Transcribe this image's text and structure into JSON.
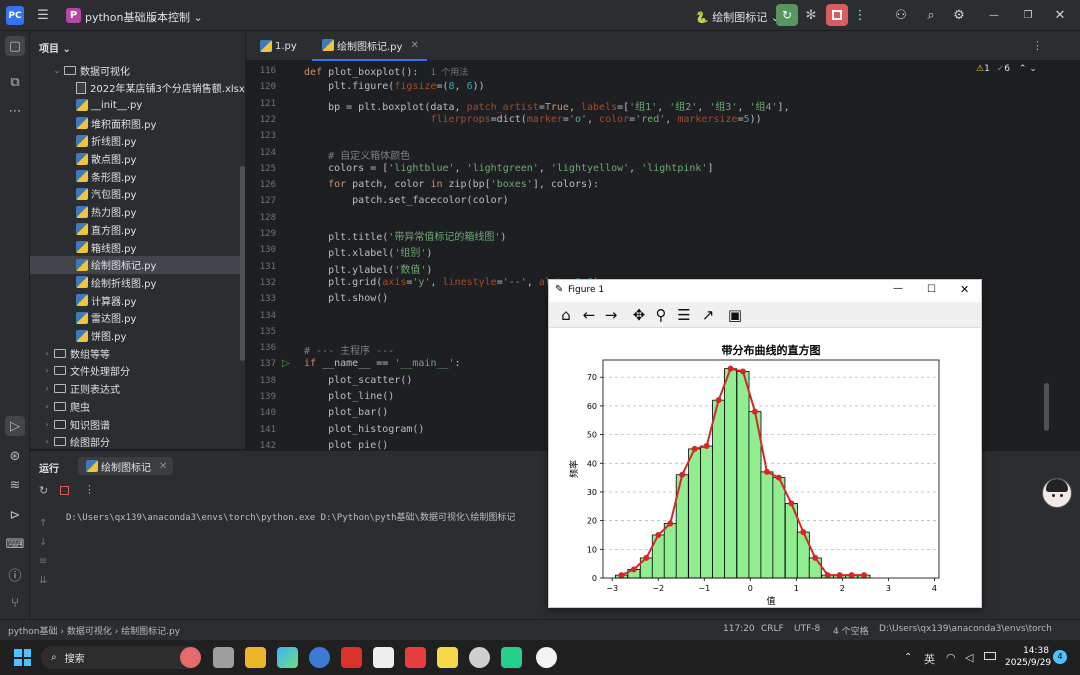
{
  "titlebar": {
    "project_badge": "P",
    "project_name": "python基础",
    "vcs": "版本控制",
    "run_config": "绘制图标记",
    "colors": {
      "run": "#57965c",
      "stop": "#db5c5c"
    }
  },
  "project_panel": {
    "title": "项目",
    "root": "数据可视化",
    "files": [
      "2022年某店铺3个分店销售额.xlsx",
      "__init__.py",
      "堆积面积图.py",
      "折线图.py",
      "散点图.py",
      "条形图.py",
      "汽包图.py",
      "热力图.py",
      "直方图.py",
      "箱线图.py",
      "绘制图标记.py",
      "绘制折线图.py",
      "计算器.py",
      "雷达图.py",
      "饼图.py"
    ],
    "selected": "绘制图标记.py",
    "folders": [
      "数组等等",
      "文件处理部分",
      "正则表达式",
      "爬虫",
      "知识图谱",
      "绘图部分"
    ]
  },
  "tabs": [
    {
      "label": "1.py"
    },
    {
      "label": "绘制图标记.py"
    }
  ],
  "editor": {
    "warn_count": "1",
    "check_count": "6",
    "usage_hint": "1 个用法",
    "lines": [
      {
        "n": "116",
        "t": "def plot_boxplot():"
      },
      {
        "n": "120",
        "t": "    plt.figure(figsize=(8, 6))"
      },
      {
        "n": "121",
        "t": "    bp = plt.boxplot(data, patch_artist=True, labels=['组1', '组2', '组3', '组4'],"
      },
      {
        "n": "122",
        "t": "                     flierprops=dict(marker='o', color='red', markersize=5))"
      },
      {
        "n": "123",
        "t": ""
      },
      {
        "n": "124",
        "t": "    # 自定义箱体颜色"
      },
      {
        "n": "125",
        "t": "    colors = ['lightblue', 'lightgreen', 'lightyellow', 'lightpink']"
      },
      {
        "n": "126",
        "t": "    for patch, color in zip(bp['boxes'], colors):"
      },
      {
        "n": "127",
        "t": "        patch.set_facecolor(color)"
      },
      {
        "n": "128",
        "t": ""
      },
      {
        "n": "129",
        "t": "    plt.title('带异常值标记的箱线图')"
      },
      {
        "n": "130",
        "t": "    plt.xlabel('组别')"
      },
      {
        "n": "131",
        "t": "    plt.ylabel('数值')"
      },
      {
        "n": "132",
        "t": "    plt.grid(axis='y', linestyle='--', alpha=0.6)"
      },
      {
        "n": "133",
        "t": "    plt.show()"
      },
      {
        "n": "134",
        "t": ""
      },
      {
        "n": "135",
        "t": ""
      },
      {
        "n": "136",
        "t": "# --- 主程序 ---"
      },
      {
        "n": "137",
        "t": "if __name__ == '__main__':"
      },
      {
        "n": "138",
        "t": "    plot_scatter()"
      },
      {
        "n": "139",
        "t": "    plot_line()"
      },
      {
        "n": "140",
        "t": "    plot_bar()"
      },
      {
        "n": "141",
        "t": "    plot_histogram()"
      },
      {
        "n": "142",
        "t": "    plot_pie()"
      }
    ]
  },
  "run": {
    "title": "运行",
    "tab": "绘制图标记",
    "output": "D:\\Users\\qx139\\anaconda3\\envs\\torch\\python.exe D:\\Python\\pyth基础\\数据可视化\\绘制图标记"
  },
  "statusbar": {
    "crumbs": [
      "python基础",
      "数据可视化",
      "绘制图标记.py"
    ],
    "position": "117:20",
    "line_sep": "CRLF",
    "encoding": "UTF-8",
    "indent": "4 个空格",
    "interpreter": "D:\\Users\\qx139\\anaconda3\\envs\\torch"
  },
  "taskbar": {
    "search": "搜索",
    "ime": "英",
    "time": "14:38",
    "date": "2025/9/29",
    "notif": "4"
  },
  "figure": {
    "title": "Figure 1",
    "toolbar_icons": [
      "home-icon",
      "back-icon",
      "forward-icon",
      "pan-icon",
      "zoom-icon",
      "configure-icon",
      "axes-edit-icon",
      "save-icon"
    ]
  },
  "chart_data": {
    "type": "bar",
    "title": "带分布曲线的直方图",
    "xlabel": "值",
    "ylabel": "频率",
    "xlim": [
      -3.2,
      4.1
    ],
    "ylim": [
      0,
      76
    ],
    "xticks": [
      -3,
      -2,
      -1,
      0,
      1,
      2,
      3,
      4
    ],
    "yticks": [
      0,
      10,
      20,
      30,
      40,
      50,
      60,
      70
    ],
    "grid": "y-dashed",
    "bar_color": "#90ee90",
    "line_color": "#d62728",
    "bins": [
      {
        "x": -2.93,
        "v": 1
      },
      {
        "x": -2.66,
        "v": 3
      },
      {
        "x": -2.39,
        "v": 7
      },
      {
        "x": -2.13,
        "v": 15
      },
      {
        "x": -1.87,
        "v": 19
      },
      {
        "x": -1.61,
        "v": 36
      },
      {
        "x": -1.34,
        "v": 45
      },
      {
        "x": -1.08,
        "v": 46
      },
      {
        "x": -0.82,
        "v": 62
      },
      {
        "x": -0.56,
        "v": 73
      },
      {
        "x": -0.29,
        "v": 72
      },
      {
        "x": -0.03,
        "v": 58
      },
      {
        "x": 0.23,
        "v": 37
      },
      {
        "x": 0.49,
        "v": 35
      },
      {
        "x": 0.76,
        "v": 26
      },
      {
        "x": 1.02,
        "v": 16
      },
      {
        "x": 1.28,
        "v": 7
      },
      {
        "x": 1.55,
        "v": 1
      },
      {
        "x": 1.81,
        "v": 1
      },
      {
        "x": 2.07,
        "v": 1
      },
      {
        "x": 2.34,
        "v": 1
      }
    ],
    "bin_width": 0.263
  }
}
